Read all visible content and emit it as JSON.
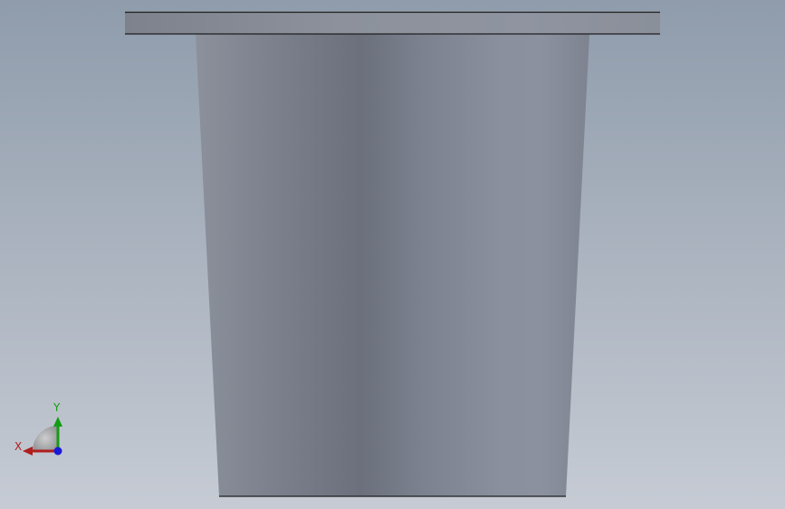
{
  "viewport": {
    "background_top": "#8f9cac",
    "background_bottom": "#c6cbd4"
  },
  "model": {
    "body_shading": [
      "#8c919c",
      "#7b808c",
      "#6b707c",
      "#7c828f",
      "#8a909d",
      "#8b919f",
      "#7e8390"
    ],
    "flange_fill": "#8a909b",
    "edge_color": "#1f1f1f"
  },
  "triad": {
    "x_label": "X",
    "y_label": "Y",
    "x_color": "#b01e1e",
    "y_color": "#149c14",
    "z_color": "#1a1ad6"
  }
}
